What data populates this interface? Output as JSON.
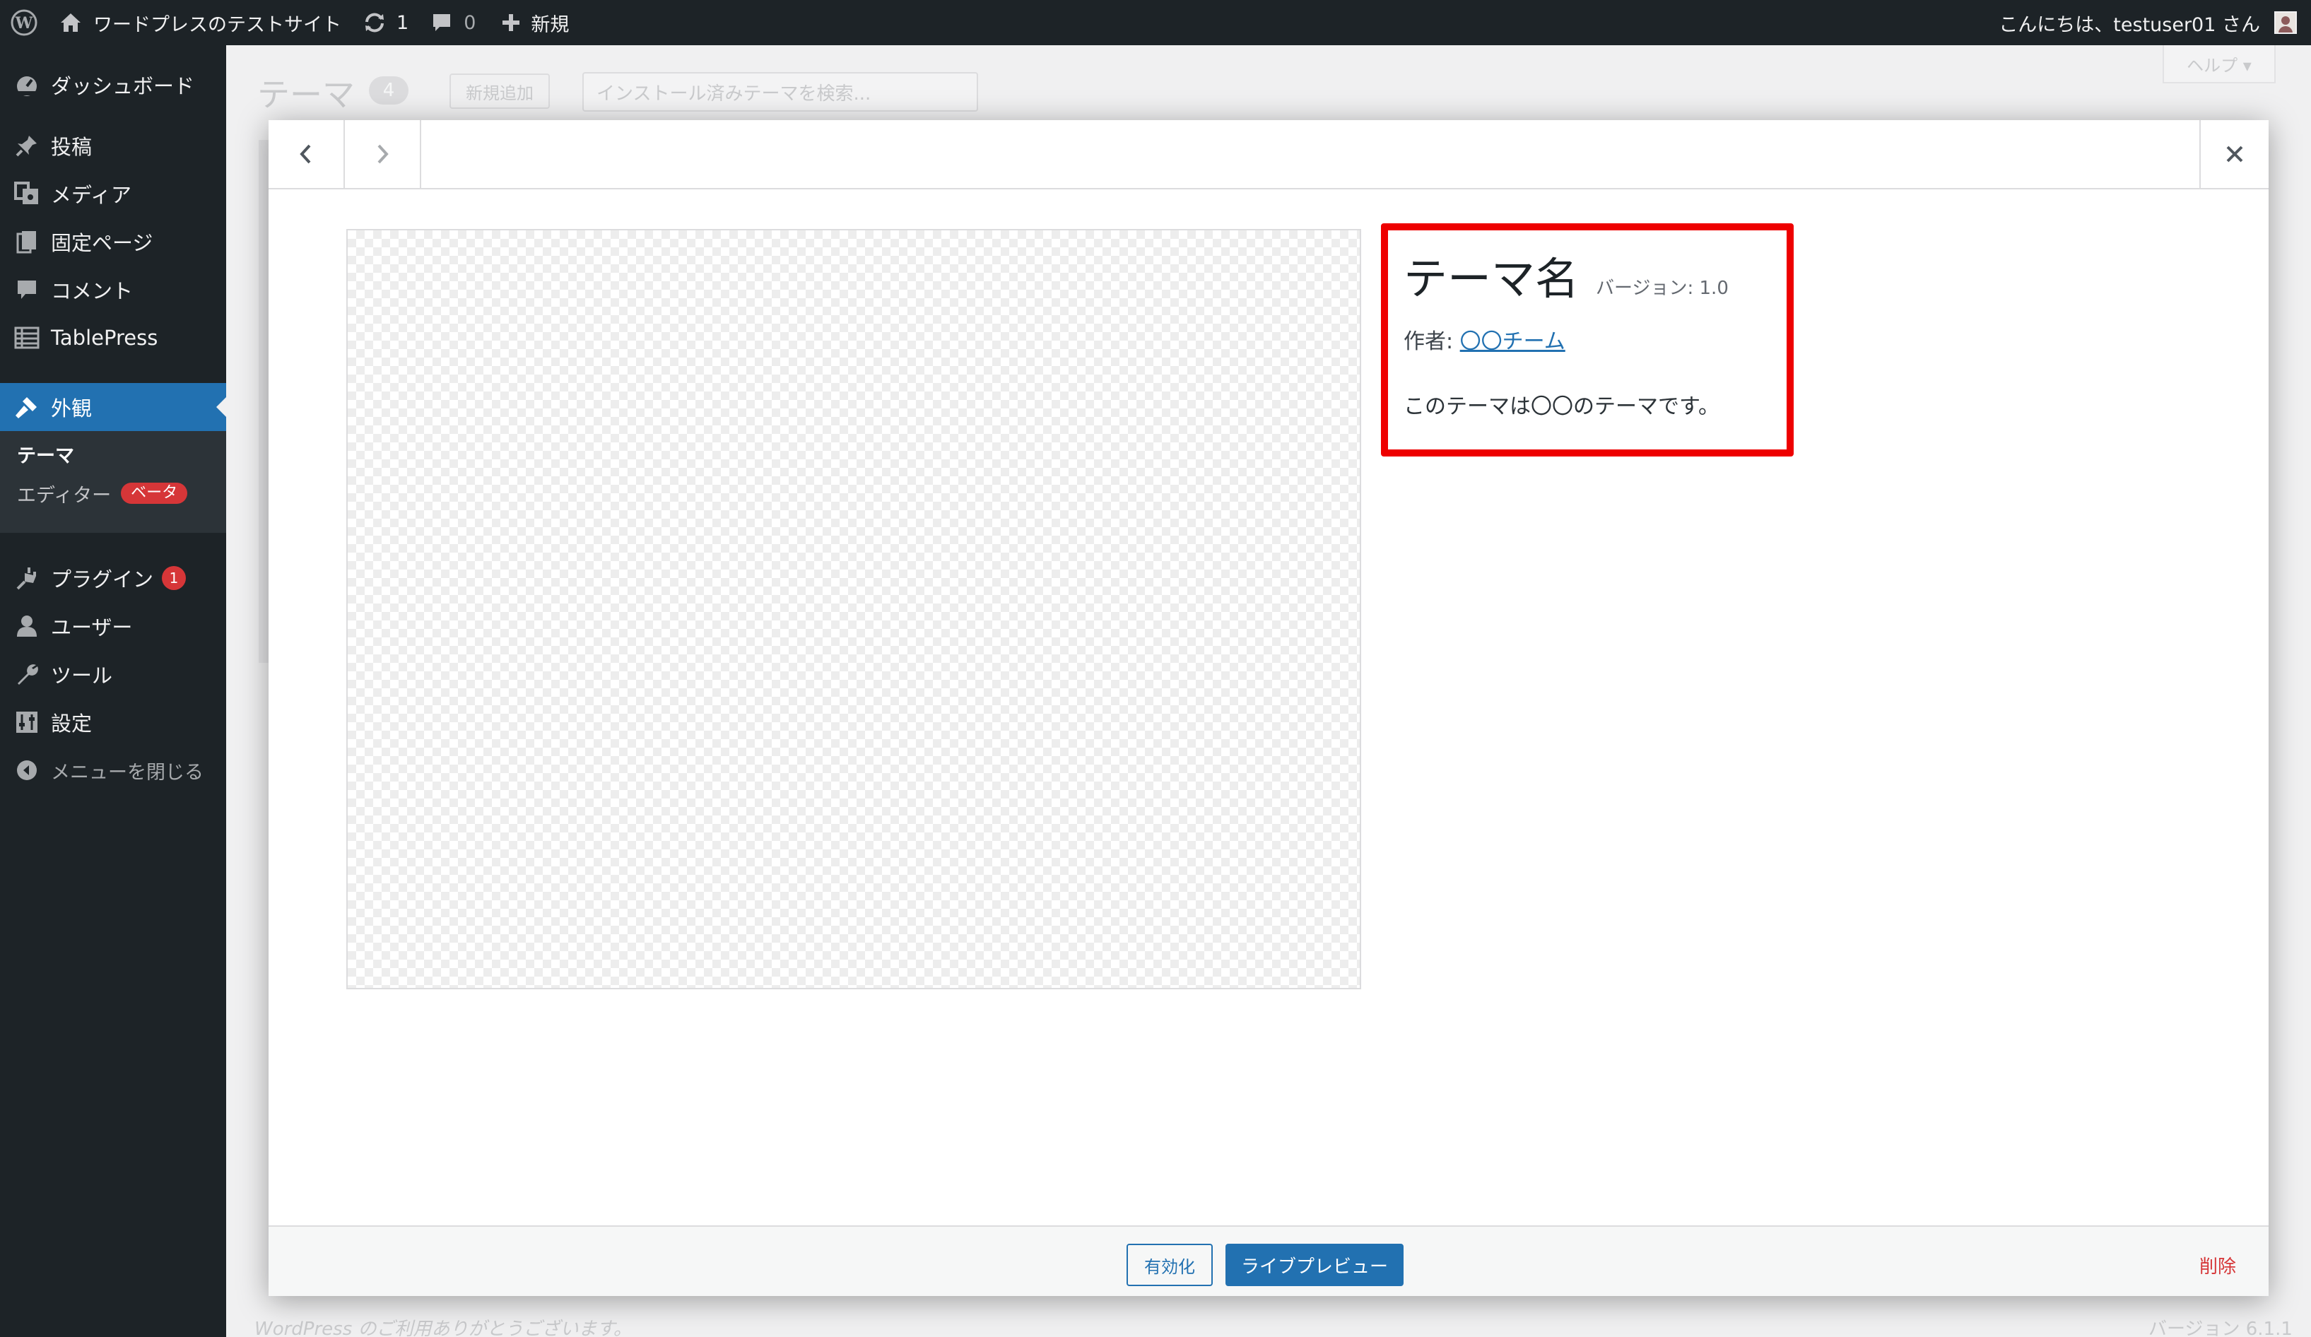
{
  "adminbar": {
    "site_name": "ワードプレスのテストサイト",
    "updates_count": "1",
    "comments_count": "0",
    "new_label": "新規",
    "greeting": "こんにちは、testuser01 さん"
  },
  "sidebar": {
    "items": [
      {
        "label": "ダッシュボード"
      },
      {
        "label": "投稿"
      },
      {
        "label": "メディア"
      },
      {
        "label": "固定ページ"
      },
      {
        "label": "コメント"
      },
      {
        "label": "TablePress"
      },
      {
        "label": "外観"
      },
      {
        "label": "プラグイン",
        "badge": "1"
      },
      {
        "label": "ユーザー"
      },
      {
        "label": "ツール"
      },
      {
        "label": "設定"
      },
      {
        "label": "メニューを閉じる"
      }
    ],
    "submenu": [
      {
        "label": "テーマ"
      },
      {
        "label": "エディター",
        "badge": "ベータ"
      }
    ]
  },
  "background": {
    "page_title": "テーマ",
    "theme_count": "4",
    "add_new": "新規追加",
    "search_placeholder": "インストール済みテーマを検索...",
    "help": "ヘルプ ▾",
    "footer_left": "WordPress のご利用ありがとうございます。",
    "footer_right": "バージョン 6.1.1"
  },
  "modal": {
    "theme_name": "テーマ名",
    "version": "バージョン: 1.0",
    "author_prefix": "作者: ",
    "author_name": "〇〇チーム",
    "description": "このテーマは〇〇のテーマです。",
    "activate": "有効化",
    "live_preview": "ライブプレビュー",
    "delete": "削除"
  },
  "colors": {
    "admin_dark": "#1d2327",
    "accent": "#2271b1",
    "highlight_box": "#ee0000",
    "danger": "#d63638"
  }
}
